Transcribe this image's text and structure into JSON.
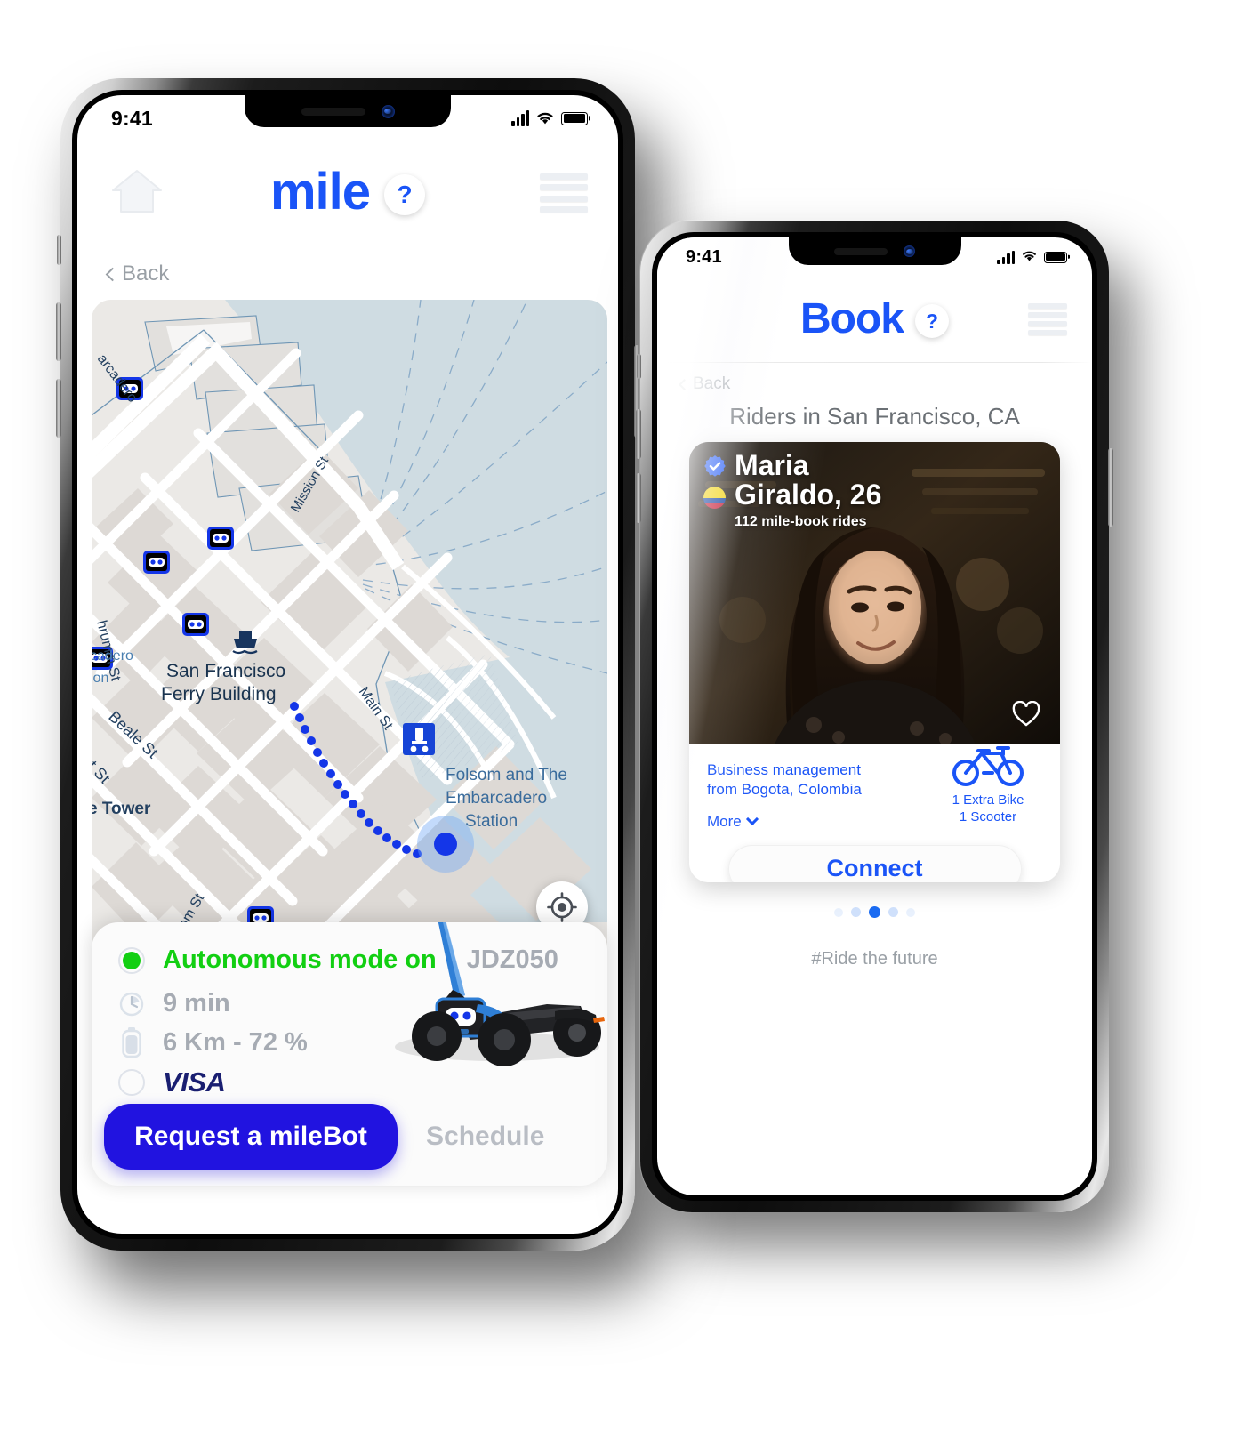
{
  "phone1": {
    "status": {
      "time": "9:41",
      "signal_icon": "cellular-bars-icon",
      "wifi_icon": "wifi-icon",
      "battery_icon": "battery-icon"
    },
    "header": {
      "home_icon": "home-icon",
      "brand": "mile",
      "help_label": "?",
      "menu_icon": "hamburger-menu-icon"
    },
    "back_label": "Back",
    "map": {
      "labels": [
        "arcadero",
        "San Francisco",
        "Ferry Building",
        "hrumm St",
        "cadero",
        "ion",
        "Beale St",
        "nt St",
        "e Tower",
        "Mission St",
        "Main St",
        "Folsom and The",
        "Embarcadero",
        "Station",
        "lsom St"
      ],
      "ferry_icon": "ferry-terminal-icon",
      "station_icon": "scooter-station-icon",
      "bot_marker_icon": "milebot-marker-icon",
      "bot_markers": 7,
      "locate_icon": "locate-me-icon",
      "route_style": "dotted-blue"
    },
    "card": {
      "status_text": "Autonomous mode on",
      "status_icon": "radio-selected-icon",
      "plate": "JDZ050",
      "eta_icon": "clock-icon",
      "eta": "9 min",
      "battery_icon": "battery-vertical-icon",
      "range": "6 Km  -  72 %",
      "payment_icon": "radio-unselected-icon",
      "payment": "VISA",
      "primary_button": "Request a mileBot",
      "secondary_button": "Schedule",
      "vehicle_image": "milebot-scooter-photo"
    },
    "colors": {
      "brand": "#1a54f7",
      "cta": "#2113e0",
      "status_on": "#12cf12",
      "visa": "#1a1f71"
    }
  },
  "phone2": {
    "status": {
      "time": "9:41",
      "signal_icon": "cellular-bars-icon",
      "wifi_icon": "wifi-icon",
      "battery_icon": "battery-icon"
    },
    "header": {
      "brand": "Book",
      "help_label": "?",
      "menu_icon": "hamburger-menu-icon"
    },
    "back_label": "Back",
    "section_title": "Riders in San Francisco, CA",
    "profile": {
      "verified_icon": "verified-badge-icon",
      "flag_icon": "colombia-flag-icon",
      "name_line1": "Maria",
      "name_line2": "Giraldo, 26",
      "rides": "112 mile-book rides",
      "photo": "rider-profile-photo",
      "favorite_icon": "heart-outline-icon",
      "bio_line1": "Business management",
      "bio_line2": "from Bogota, Colombia",
      "more_label": "More",
      "more_icon": "chevron-down-icon",
      "bike_icon": "bicycle-icon",
      "vehicle_line1": "1 Extra Bike",
      "vehicle_line2": "1 Scooter",
      "connect_button": "Connect"
    },
    "carousel": {
      "total": 5,
      "active_index": 2
    },
    "tagline": "#Ride the future",
    "colors": {
      "brand": "#1a54f7",
      "dot_active": "#1a6bf2",
      "dot_inactive": "#cfe0fb"
    }
  }
}
